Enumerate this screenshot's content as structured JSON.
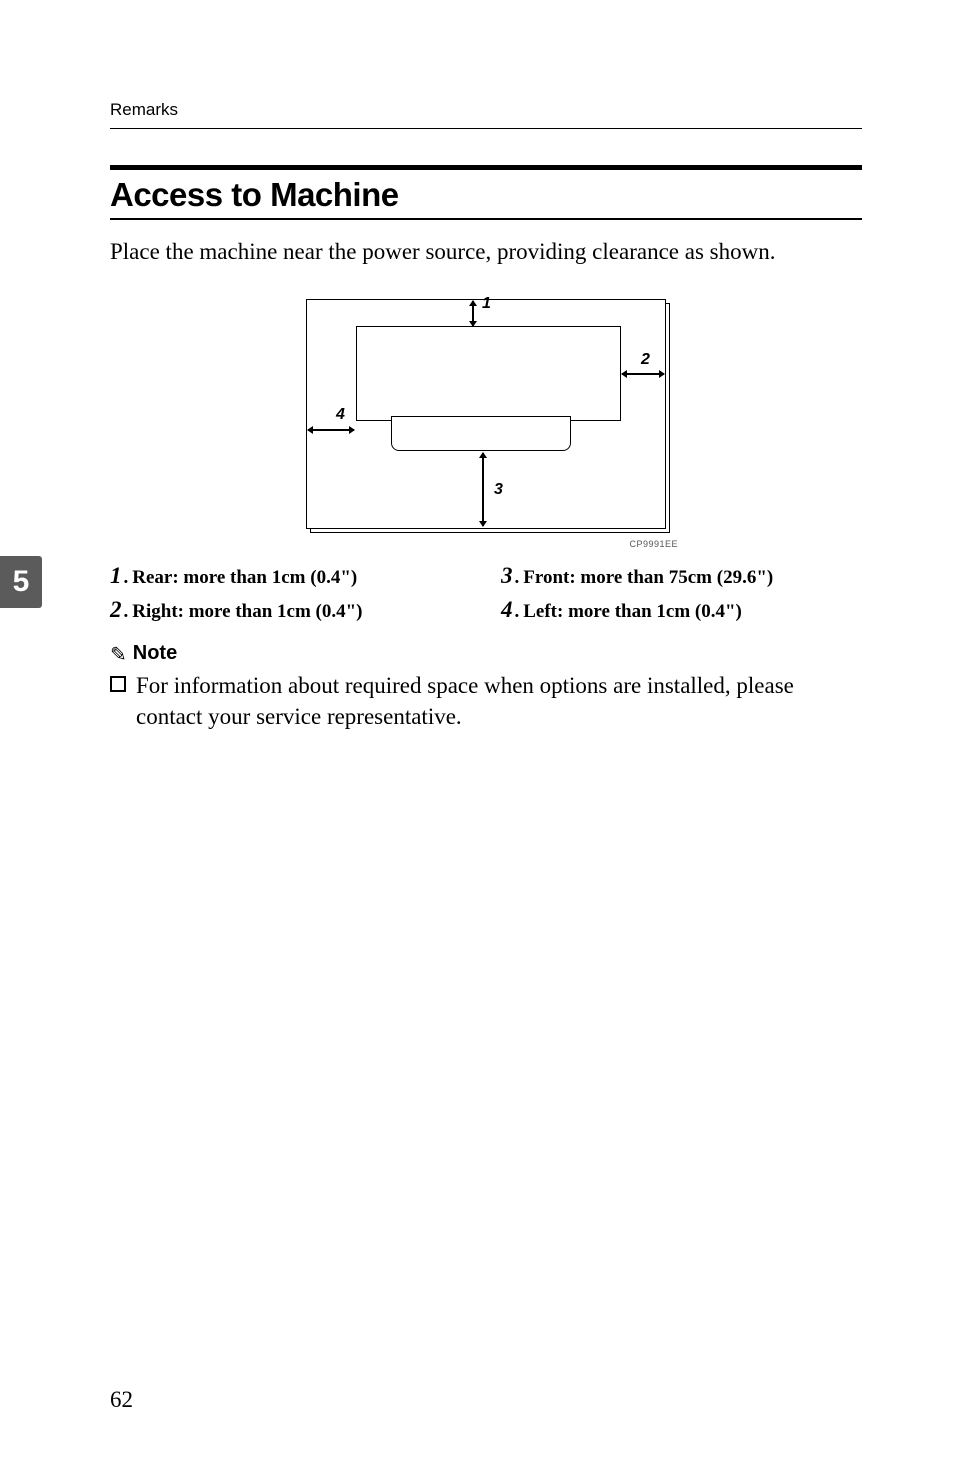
{
  "running_header": "Remarks",
  "section_tab": "5",
  "heading": "Access to Machine",
  "intro": "Place the machine near the power source, providing clearance as shown.",
  "diagram": {
    "labels": {
      "l1": "1",
      "l2": "2",
      "l3": "3",
      "l4": "4"
    },
    "code": "CP9991EE"
  },
  "callouts": {
    "left": [
      {
        "num": "1",
        "text": "Rear: more than 1cm (0.4\")"
      },
      {
        "num": "2",
        "text": "Right: more than 1cm (0.4\")"
      }
    ],
    "right": [
      {
        "num": "3",
        "text": "Front: more than 75cm (29.6\")"
      },
      {
        "num": "4",
        "text": "Left: more than 1cm (0.4\")"
      }
    ]
  },
  "note": {
    "heading": "Note",
    "icon": "✎",
    "body": "For information about required space when options are installed, please contact your service representative."
  },
  "page_number": "62"
}
